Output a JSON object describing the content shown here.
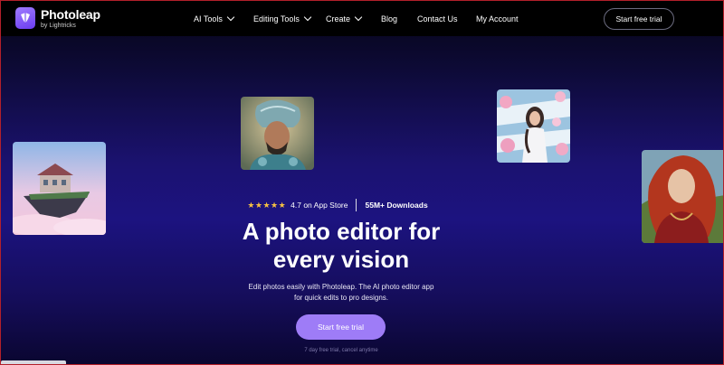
{
  "brand": {
    "name": "Photoleap",
    "sub": "by Lightricks"
  },
  "nav": [
    {
      "label": "AI Tools",
      "dropdown": true
    },
    {
      "label": "Editing Tools",
      "dropdown": true
    },
    {
      "label": "Create",
      "dropdown": true
    },
    {
      "label": "Blog",
      "dropdown": false
    },
    {
      "label": "Contact Us",
      "dropdown": false
    },
    {
      "label": "My Account",
      "dropdown": false
    }
  ],
  "header": {
    "cta_label": "Start free trial"
  },
  "hero": {
    "stars": "★★★★★",
    "rating_text": "4.7 on App Store",
    "downloads_text": "55M+ Downloads",
    "title_line1": "A photo editor for",
    "title_line2": "every vision",
    "subtitle": "Edit photos easily with Photoleap. The AI photo editor app for quick edits to pro designs.",
    "cta_label": "Start free trial",
    "trial_note": "7 day free trial, cancel anytime"
  },
  "colors": {
    "accent": "#9e7cf7",
    "star": "#f6c142",
    "frame_border": "#b3202a"
  },
  "images": [
    {
      "name": "floating-house-image"
    },
    {
      "name": "warrior-portrait-image"
    },
    {
      "name": "woman-flowers-image"
    },
    {
      "name": "redhead-portrait-image"
    }
  ]
}
